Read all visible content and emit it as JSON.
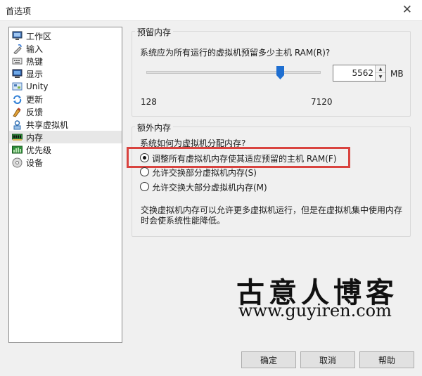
{
  "window": {
    "title": "首选项",
    "close_glyph": "✕"
  },
  "sidebar": {
    "items": [
      {
        "label": "工作区",
        "icon": "monitor-icon"
      },
      {
        "label": "输入",
        "icon": "input-icon"
      },
      {
        "label": "热键",
        "icon": "keyboard-icon"
      },
      {
        "label": "显示",
        "icon": "display-icon"
      },
      {
        "label": "Unity",
        "icon": "unity-icon"
      },
      {
        "label": "更新",
        "icon": "refresh-icon"
      },
      {
        "label": "反馈",
        "icon": "feedback-icon"
      },
      {
        "label": "共享虚拟机",
        "icon": "share-icon"
      },
      {
        "label": "内存",
        "icon": "memory-icon",
        "selected": true
      },
      {
        "label": "优先级",
        "icon": "priority-icon"
      },
      {
        "label": "设备",
        "icon": "device-icon"
      }
    ]
  },
  "reserved_memory": {
    "group_title": "预留内存",
    "question": "系统应为所有运行的虚拟机预留多少主机 RAM(R)?",
    "slider_min": "128",
    "slider_max": "7120",
    "slider_value": 5562,
    "spin_value": "5562",
    "unit": "MB"
  },
  "extra_memory": {
    "group_title": "额外内存",
    "question": "系统如何为虚拟机分配内存?",
    "options": [
      {
        "label": "调整所有虚拟机内存使其适应预留的主机 RAM(F)",
        "checked": true
      },
      {
        "label": "允许交换部分虚拟机内存(S)",
        "checked": false
      },
      {
        "label": "允许交换大部分虚拟机内存(M)",
        "checked": false
      }
    ],
    "note_line1": "交换虚拟机内存可以允许更多虚拟机运行，但是在虚拟机集中使用内存",
    "note_line2": "时会使系统性能降低。"
  },
  "watermark": {
    "cn": "古意人博客",
    "url": "www.guyiren.com"
  },
  "buttons": {
    "ok": "确定",
    "cancel": "取消",
    "help": "帮助"
  },
  "colors": {
    "highlight": "#d9433f",
    "slider_thumb": "#1f6fd1"
  }
}
